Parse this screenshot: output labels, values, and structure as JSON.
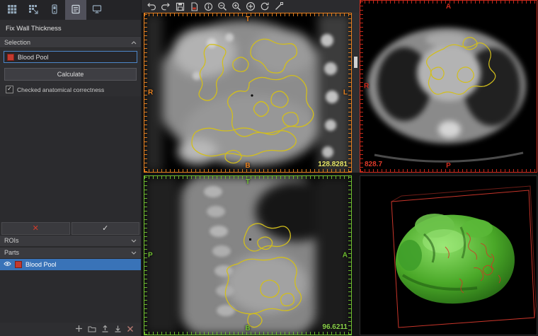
{
  "sidebar": {
    "panel_title": "Fix Wall Thickness",
    "selection": {
      "header": "Selection",
      "item_label": "Blood Pool",
      "item_color": "#c43a2e",
      "calculate_label": "Calculate",
      "checkbox_label": "Checked anatomical correctness",
      "checkbox_glyph": "✓"
    },
    "confirm": {
      "reject_glyph": "✕",
      "accept_glyph": "✓"
    },
    "rois_header": "ROIs",
    "parts_header": "Parts",
    "parts": [
      {
        "label": "Blood Pool",
        "color": "#c43a2e",
        "selected": true,
        "visible": true
      }
    ],
    "toolbar_icons": [
      "layout-grid-icon",
      "layout-grid-arrow-icon",
      "call-icon",
      "segment-panel-icon",
      "monitor-icon"
    ],
    "bottom_toolbar_icons": [
      "add-icon",
      "folder-icon",
      "export-icon",
      "import-icon",
      "delete-icon"
    ]
  },
  "viewer": {
    "toolbar_icons": [
      "undo-icon",
      "redo-icon",
      "save-icon",
      "export-pdf-icon",
      "info-icon",
      "zoom-out-icon",
      "zoom-in-icon",
      "add-circle-icon",
      "reset-view-icon",
      "measure-icon"
    ],
    "contour_color": "#d2be1c",
    "viewports": {
      "coronal": {
        "accent": "#e6801f",
        "slice_value": "128.8281",
        "orientation": {
          "top": "T",
          "left": "R",
          "right": "L",
          "bottom": "B"
        }
      },
      "axial": {
        "accent": "#cf2a1c",
        "slice_value": "828.7",
        "orientation": {
          "top": "A",
          "left": "R",
          "bottom": "P"
        }
      },
      "sagittal": {
        "accent": "#6fbe30",
        "slice_value": "96.6211",
        "orientation": {
          "top": "T",
          "left": "P",
          "right": "A",
          "bottom": "B"
        }
      },
      "volume_3d": {
        "model": "green heart segmentation with red contour overlay"
      }
    }
  },
  "colors": {
    "selection_highlight": "#3973b8",
    "sidebar_bg": "#2e2e31",
    "viewport_bg": "#000000"
  }
}
